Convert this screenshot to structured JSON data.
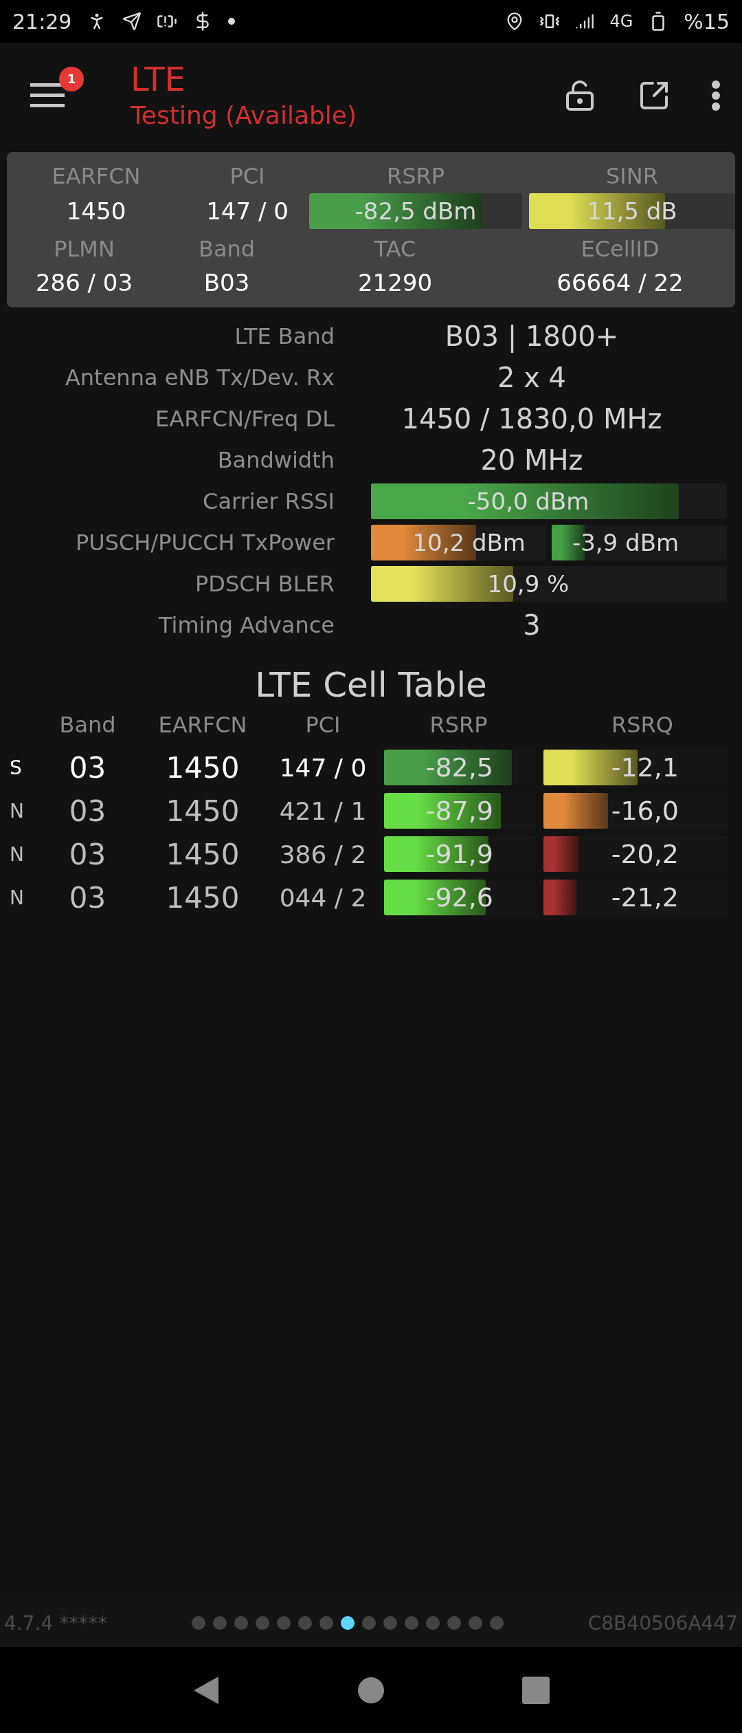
{
  "status_bar": {
    "time": "21:29",
    "network": "4G",
    "battery": "%15"
  },
  "header": {
    "title": "LTE",
    "subtitle": "Testing (Available)",
    "badge": "1"
  },
  "summary": {
    "row1": [
      {
        "kind": "text",
        "label": "EARFCN",
        "value": "1450"
      },
      {
        "kind": "text",
        "label": "PCI",
        "value": "147 / 0"
      },
      {
        "kind": "bar",
        "label": "RSRP",
        "value": "-82,5 dBm",
        "level": 0.81,
        "color": "#4a9e4a"
      },
      {
        "kind": "bar",
        "label": "SINR",
        "value": "11,5 dB",
        "level": 0.66,
        "color": "#dede55"
      }
    ],
    "row2": [
      {
        "label": "PLMN",
        "value": "286 / 03"
      },
      {
        "label": "Band",
        "value": "B03"
      },
      {
        "label": "TAC",
        "value": "21290"
      },
      {
        "label": "ECellID",
        "value": "66664 / 22"
      }
    ]
  },
  "details": [
    {
      "kind": "text",
      "label": "LTE Band",
      "value": "B03 | 1800+"
    },
    {
      "kind": "text",
      "label": "Antenna eNB Tx/Dev. Rx",
      "value": "2 x 4"
    },
    {
      "kind": "text",
      "label": "EARFCN/Freq DL",
      "value": "1450 / 1830,0 MHz"
    },
    {
      "kind": "text",
      "label": "Bandwidth",
      "value": "20 MHz"
    },
    {
      "kind": "bar",
      "label": "Carrier RSSI",
      "value": "-50,0 dBm",
      "level": 0.865,
      "color": "#4aa84a"
    },
    {
      "kind": "dual_bar",
      "label": "PUSCH/PUCCH TxPower",
      "bars": [
        {
          "value": "10,2 dBm",
          "level": 0.6,
          "color": "#e08a3c"
        },
        {
          "value": "-3,9 dBm",
          "level": 0.19,
          "color": "#46a046"
        }
      ]
    },
    {
      "kind": "bar",
      "label": "PDSCH BLER",
      "value": "10,9 %",
      "level": 0.4,
      "color": "#e2e25a"
    },
    {
      "kind": "text",
      "label": "Timing Advance",
      "value": "3"
    }
  ],
  "cell_table": {
    "title": "LTE Cell Table",
    "columns": [
      "Band",
      "EARFCN",
      "PCI",
      "RSRP",
      "RSRQ"
    ],
    "rows": [
      {
        "type": "S",
        "serving": true,
        "band": "03",
        "earfcn": "1450",
        "pci": "147 / 0",
        "rsrp": {
          "value": "-82,5",
          "level": 0.84,
          "color": "#4a9e4a"
        },
        "rsrq": {
          "value": "-12,1",
          "level": 0.51,
          "color": "#dede55"
        }
      },
      {
        "type": "N",
        "serving": false,
        "band": "03",
        "earfcn": "1450",
        "pci": "421 / 1",
        "rsrp": {
          "value": "-87,9",
          "level": 0.77,
          "color": "#66dd44"
        },
        "rsrq": {
          "value": "-16,0",
          "level": 0.35,
          "color": "#e08a3c"
        }
      },
      {
        "type": "N",
        "serving": false,
        "band": "03",
        "earfcn": "1450",
        "pci": "386 / 2",
        "rsrp": {
          "value": "-91,9",
          "level": 0.69,
          "color": "#66dd44"
        },
        "rsrq": {
          "value": "-20,2",
          "level": 0.19,
          "color": "#a83232"
        }
      },
      {
        "type": "N",
        "serving": false,
        "band": "03",
        "earfcn": "1450",
        "pci": "044 / 2",
        "rsrp": {
          "value": "-92,6",
          "level": 0.67,
          "color": "#66dd44"
        },
        "rsrq": {
          "value": "-21,2",
          "level": 0.18,
          "color": "#a83232"
        }
      }
    ]
  },
  "footer": {
    "version": "4.7.4 *****",
    "device_id": "C8B40506A447",
    "pages": [
      {
        "selected": false
      },
      {
        "selected": false
      },
      {
        "selected": false
      },
      {
        "selected": false
      },
      {
        "selected": false
      },
      {
        "selected": false
      },
      {
        "selected": false
      },
      {
        "selected": true
      },
      {
        "selected": false
      },
      {
        "selected": false
      },
      {
        "selected": false
      },
      {
        "selected": false
      },
      {
        "selected": false
      },
      {
        "selected": false
      },
      {
        "selected": false
      }
    ]
  }
}
